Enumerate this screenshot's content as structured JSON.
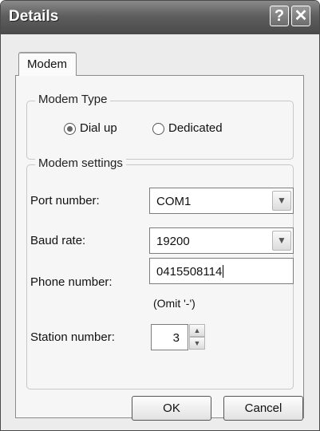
{
  "window": {
    "title": "Details",
    "help_glyph": "?",
    "close_glyph": "✕"
  },
  "tabs": [
    {
      "label": "Modem",
      "selected": true
    }
  ],
  "modem_type": {
    "title": "Modem Type",
    "options": [
      {
        "label": "Dial up",
        "selected": true
      },
      {
        "label": "Dedicated",
        "selected": false
      }
    ]
  },
  "modem_settings": {
    "title": "Modem settings",
    "port_label": "Port number:",
    "port_value": "COM1",
    "baud_label": "Baud rate:",
    "baud_value": "19200",
    "phone_label": "Phone number:",
    "phone_value": "0415508114",
    "phone_hint": "(Omit '-')",
    "station_label": "Station number:",
    "station_value": "3"
  },
  "buttons": {
    "ok": "OK",
    "cancel": "Cancel"
  },
  "icons": {
    "dropdown": "chevron-down-icon",
    "spin_up": "spin-up-icon",
    "spin_down": "spin-down-icon"
  }
}
